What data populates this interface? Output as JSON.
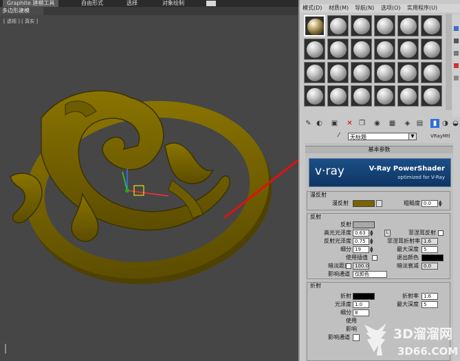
{
  "ribbon": {
    "tabs": [
      "Graphite 建模工具",
      "自由形式",
      "选择",
      "对象绘制"
    ],
    "subtab": "多边形建模"
  },
  "viewport": {
    "label": "[ 透视 ] [ 真实 ]"
  },
  "material_editor": {
    "menu": [
      "模式(D)",
      "材质(M)",
      "导航(N)",
      "选项(O)",
      "实用程序(U)"
    ],
    "material_name": "无标题",
    "material_type": "VRayMtl",
    "toolbar_icons": [
      "get-material-icon",
      "put-to-scene-icon",
      "assign-to-selection-icon",
      "reset-icon",
      "make-copy-icon",
      "unique-icon",
      "put-to-library-icon",
      "material-id-icon",
      "show-in-viewport-icon",
      "show-end-result-icon",
      "go-parent-icon",
      "go-sibling-icon"
    ],
    "rollout_title": "基本参数",
    "banner": {
      "logo": "v·ray",
      "title": "V-Ray PowerShader",
      "subtitle": "optimized for V-Ray"
    },
    "diffuse": {
      "group": "漫反射",
      "diffuse_label": "漫反射",
      "diffuse_color": "#7a6400",
      "roughness_label": "粗糙度",
      "roughness_value": "0.0"
    },
    "reflection": {
      "group": "反射",
      "reflect_label": "反射",
      "hilight_gloss_label": "高光光泽度",
      "hilight_gloss_value": "0.63",
      "fresnel_label": "菲涅耳反射",
      "refl_gloss_label": "反射光泽度",
      "refl_gloss_value": "0.75",
      "fresnel_ior_label": "菲涅耳折射率",
      "fresnel_ior_value": "1.6",
      "subdivs_label": "细分",
      "subdivs_value": "19",
      "max_depth_label": "最大深度",
      "max_depth_value": "5",
      "use_interp_label": "使用插值",
      "exit_color_label": "退出颜色",
      "dim_distance_label": "暗淡距离",
      "dim_distance_value": "100.0",
      "dim_falloff_label": "暗淡衰减",
      "dim_falloff_value": "0.0",
      "affect_channels_label": "影响通道",
      "affect_channels_value": "仅颜色"
    },
    "refraction": {
      "group": "折射",
      "refract_label": "折射",
      "ior_label": "折射率",
      "ior_value": "1.6",
      "gloss_label": "光泽度",
      "gloss_value": "1.0",
      "max_depth_label": "最大深度",
      "max_depth_value": "5",
      "subdivs_label": "细分",
      "subdivs_value": "8",
      "use_label": "使用",
      "affect_label": "影响",
      "affect_channels_label": "影响通道"
    }
  },
  "watermark": {
    "brand": "3D溜溜网",
    "url": "3D66.COM"
  }
}
